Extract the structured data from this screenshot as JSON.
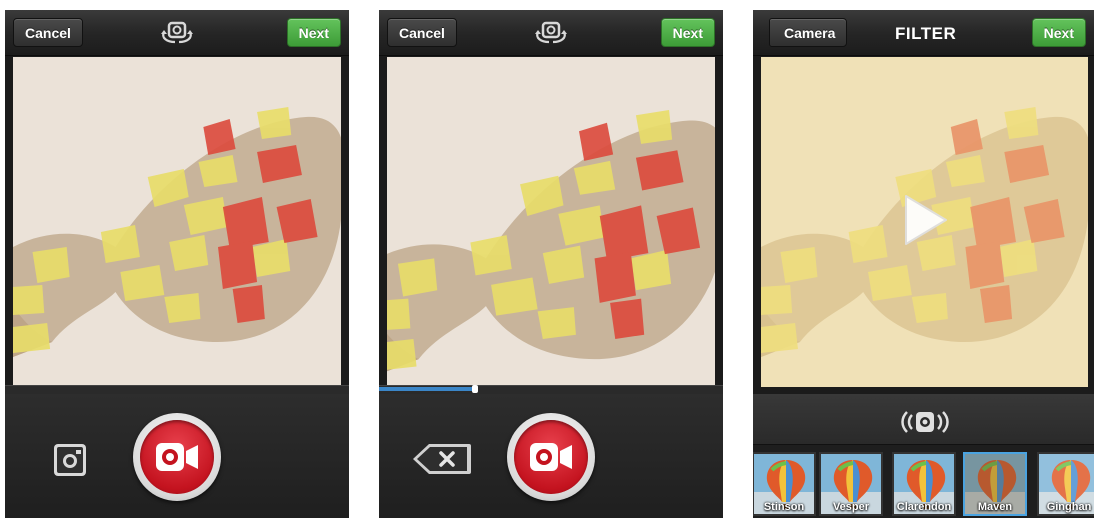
{
  "screens": [
    {
      "header": {
        "cancel_label": "Cancel",
        "next_label": "Next",
        "flip_icon": "camera-flip-icon"
      },
      "progress": 0,
      "bottom": {
        "gallery_icon": "photo-library-icon",
        "record_icon": "video-record-icon"
      }
    },
    {
      "header": {
        "cancel_label": "Cancel",
        "next_label": "Next",
        "flip_icon": "camera-flip-icon"
      },
      "progress": 0.28,
      "bottom": {
        "delete_icon": "delete-clip-icon",
        "record_icon": "video-record-icon"
      }
    },
    {
      "header": {
        "back_label": "Camera",
        "title": "FILTER",
        "next_label": "Next"
      },
      "play_icon": "play-icon",
      "stabilize_icon": "stabilization-icon",
      "filters": [
        {
          "label": "Stinson",
          "selected": false
        },
        {
          "label": "Vesper",
          "selected": false
        },
        {
          "label": "Clarendon",
          "selected": false
        },
        {
          "label": "Maven",
          "selected": true
        },
        {
          "label": "Ginghan",
          "selected": false
        }
      ]
    }
  ],
  "colors": {
    "accent_green": "#4caf46",
    "record_red": "#d21a26",
    "progress_blue": "#3b86c8",
    "selected_border": "#4aa3e0"
  }
}
